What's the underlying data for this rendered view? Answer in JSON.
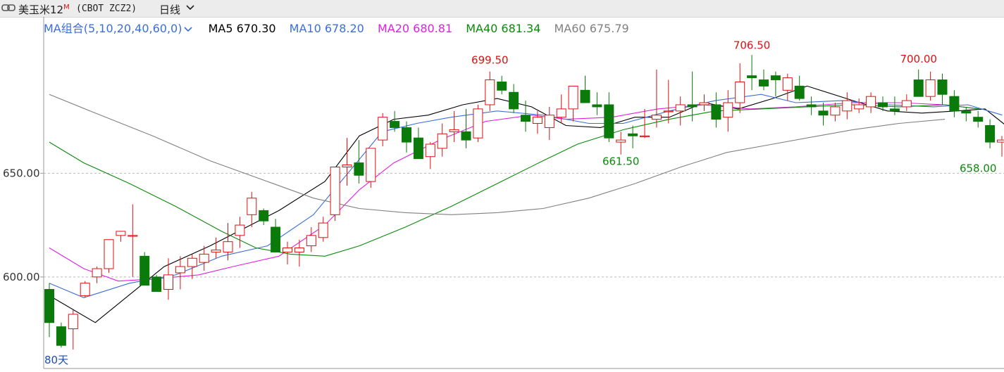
{
  "header": {
    "instrument": "美玉米12",
    "superscript": "M",
    "code": "(CBOT ZCZ2)",
    "period": "日线"
  },
  "ma_legend": [
    {
      "label": "MA组合(5,10,20,40,60,0)",
      "color": "#3b6fd6"
    },
    {
      "label": "MA5 670.30",
      "color": "#000000"
    },
    {
      "label": "MA10 678.20",
      "color": "#3b6fd6"
    },
    {
      "label": "MA20 680.81",
      "color": "#e020e0"
    },
    {
      "label": "MA40 681.34",
      "color": "#0a8a0a"
    },
    {
      "label": "MA60 675.79",
      "color": "#808080"
    }
  ],
  "chart_data": {
    "type": "candlestick",
    "y_ticks": [
      {
        "value": 600,
        "label": "600.00"
      },
      {
        "value": 650,
        "label": "650.00"
      }
    ],
    "ylim": [
      555,
      720
    ],
    "window_label": "80天",
    "annotations": [
      {
        "label": "699.50",
        "index": 37,
        "value": 699.5,
        "position": "above",
        "color": "#e01010"
      },
      {
        "label": "706.50",
        "index": 59,
        "value": 706.5,
        "position": "above",
        "color": "#e01010"
      },
      {
        "label": "661.50",
        "index": 48,
        "value": 661.5,
        "position": "below",
        "color": "#0a8a0a"
      },
      {
        "label": "700.00",
        "index": 73,
        "value": 700.0,
        "position": "above",
        "color": "#e01010"
      },
      {
        "label": "658.00",
        "index": 78,
        "value": 658.0,
        "position": "below",
        "color": "#0a8a0a"
      }
    ],
    "candles": [
      [
        594,
        597,
        571,
        578
      ],
      [
        576,
        578,
        566,
        567
      ],
      [
        575,
        584,
        565,
        582
      ],
      [
        591,
        598,
        590,
        597
      ],
      [
        600,
        605,
        597,
        604
      ],
      [
        604,
        616,
        602,
        618
      ],
      [
        620,
        621,
        617,
        622
      ],
      [
        620,
        635,
        600,
        620
      ],
      [
        610,
        612,
        597,
        596
      ],
      [
        600,
        601,
        593,
        593
      ],
      [
        594,
        609,
        589,
        601
      ],
      [
        602,
        610,
        594,
        605
      ],
      [
        605,
        611,
        599,
        609
      ],
      [
        607,
        615,
        603,
        611
      ],
      [
        612,
        619,
        609,
        613
      ],
      [
        612,
        626,
        608,
        617
      ],
      [
        620,
        629,
        614,
        625
      ],
      [
        630,
        641,
        624,
        638
      ],
      [
        632,
        633,
        625,
        627
      ],
      [
        624,
        628,
        614,
        612
      ],
      [
        612,
        617,
        606,
        614
      ],
      [
        612,
        618,
        605,
        614
      ],
      [
        615,
        624,
        612,
        620
      ],
      [
        619,
        629,
        617,
        626
      ],
      [
        630,
        651,
        627,
        653
      ],
      [
        653,
        667,
        644,
        654
      ],
      [
        655,
        666,
        645,
        649
      ],
      [
        646,
        657,
        643,
        662
      ],
      [
        666,
        679,
        663,
        677
      ],
      [
        675,
        680,
        670,
        672
      ],
      [
        672,
        675,
        660,
        665
      ],
      [
        667,
        672,
        657,
        657
      ],
      [
        658,
        665,
        652,
        664
      ],
      [
        662,
        674,
        658,
        669
      ],
      [
        670,
        680,
        665,
        671
      ],
      [
        670,
        681,
        662,
        666
      ],
      [
        667,
        683,
        665,
        681
      ],
      [
        683,
        699,
        680,
        695
      ],
      [
        694,
        697,
        688,
        690
      ],
      [
        689,
        693,
        679,
        681
      ],
      [
        678,
        685,
        670,
        675
      ],
      [
        674,
        680,
        669,
        677
      ],
      [
        672,
        682,
        666,
        678
      ],
      [
        677,
        688,
        674,
        681
      ],
      [
        681,
        687,
        675,
        692
      ],
      [
        690,
        697,
        685,
        684
      ],
      [
        683,
        689,
        678,
        682
      ],
      [
        683,
        689,
        665,
        667
      ],
      [
        665,
        670,
        659,
        666
      ],
      [
        669,
        673,
        662,
        668
      ],
      [
        668,
        681,
        667,
        668
      ],
      [
        676,
        700,
        672,
        678
      ],
      [
        680,
        695,
        674,
        680
      ],
      [
        680,
        687,
        673,
        683
      ],
      [
        683,
        699,
        675,
        682
      ],
      [
        683,
        688,
        680,
        684
      ],
      [
        683,
        689,
        672,
        676
      ],
      [
        677,
        690,
        670,
        684
      ],
      [
        684,
        703,
        679,
        694
      ],
      [
        697,
        707,
        690,
        696
      ],
      [
        695,
        700,
        690,
        692
      ],
      [
        697,
        699,
        687,
        695
      ],
      [
        690,
        698,
        685,
        696
      ],
      [
        692,
        697,
        685,
        686
      ],
      [
        683,
        687,
        678,
        682
      ],
      [
        680,
        684,
        673,
        678
      ],
      [
        678,
        684,
        675,
        682
      ],
      [
        680,
        689,
        676,
        685
      ],
      [
        681,
        686,
        679,
        683
      ],
      [
        682,
        689,
        679,
        687
      ],
      [
        684,
        687,
        680,
        682
      ],
      [
        681,
        687,
        678,
        680
      ],
      [
        682,
        688,
        680,
        685
      ],
      [
        695,
        700,
        687,
        687
      ],
      [
        687,
        699,
        685,
        695
      ],
      [
        695,
        698,
        683,
        688
      ],
      [
        687,
        690,
        677,
        680
      ],
      [
        680,
        682,
        675,
        679
      ],
      [
        677,
        680,
        672,
        675
      ],
      [
        673,
        676,
        662,
        665
      ],
      [
        665,
        668,
        658,
        666
      ],
      [
        665,
        667,
        662,
        665
      ]
    ],
    "series": [
      {
        "name": "MA5",
        "color": "#000000",
        "values": [
          [
            0,
            591
          ],
          [
            8,
            578
          ],
          [
            20,
            605
          ],
          [
            28,
            615
          ],
          [
            40,
            632
          ],
          [
            48,
            646
          ],
          [
            54,
            668
          ],
          [
            60,
            676
          ],
          [
            66,
            678
          ],
          [
            72,
            683
          ],
          [
            78,
            686
          ],
          [
            84,
            682
          ],
          [
            90,
            673
          ],
          [
            96,
            672
          ],
          [
            102,
            677
          ],
          [
            108,
            677
          ],
          [
            114,
            684
          ],
          [
            120,
            681
          ],
          [
            126,
            686
          ],
          [
            132,
            692
          ],
          [
            140,
            685
          ],
          [
            146,
            680
          ],
          [
            152,
            679
          ],
          [
            158,
            680
          ],
          [
            163,
            681
          ],
          [
            168,
            670
          ]
        ]
      },
      {
        "name": "MA10",
        "color": "#3b6fd6",
        "values": [
          [
            0,
            597
          ],
          [
            6,
            590
          ],
          [
            14,
            597
          ],
          [
            22,
            601
          ],
          [
            30,
            610
          ],
          [
            38,
            615
          ],
          [
            46,
            630
          ],
          [
            52,
            650
          ],
          [
            58,
            670
          ],
          [
            64,
            674
          ],
          [
            70,
            677
          ],
          [
            78,
            680
          ],
          [
            86,
            678
          ],
          [
            94,
            674
          ],
          [
            100,
            674
          ],
          [
            108,
            680
          ],
          [
            116,
            685
          ],
          [
            124,
            688
          ],
          [
            130,
            684
          ],
          [
            138,
            685
          ],
          [
            146,
            683
          ],
          [
            154,
            682
          ],
          [
            160,
            683
          ],
          [
            166,
            678
          ]
        ]
      },
      {
        "name": "MA20",
        "color": "#e020e0",
        "values": [
          [
            0,
            614
          ],
          [
            6,
            604
          ],
          [
            12,
            598
          ],
          [
            18,
            599
          ],
          [
            26,
            601
          ],
          [
            32,
            605
          ],
          [
            40,
            610
          ],
          [
            48,
            625
          ],
          [
            54,
            642
          ],
          [
            60,
            655
          ],
          [
            68,
            666
          ],
          [
            76,
            675
          ],
          [
            84,
            678
          ],
          [
            90,
            676
          ],
          [
            98,
            677
          ],
          [
            106,
            681
          ],
          [
            114,
            683
          ],
          [
            122,
            681
          ],
          [
            130,
            682
          ],
          [
            140,
            684
          ],
          [
            148,
            684
          ],
          [
            156,
            683
          ],
          [
            162,
            681
          ]
        ]
      },
      {
        "name": "MA40",
        "color": "#0a8a0a",
        "values": [
          [
            0,
            665
          ],
          [
            6,
            655
          ],
          [
            14,
            645
          ],
          [
            22,
            634
          ],
          [
            30,
            622
          ],
          [
            36,
            614
          ],
          [
            42,
            611
          ],
          [
            48,
            610
          ],
          [
            54,
            615
          ],
          [
            62,
            624
          ],
          [
            70,
            634
          ],
          [
            78,
            645
          ],
          [
            86,
            656
          ],
          [
            92,
            664
          ],
          [
            100,
            671
          ],
          [
            108,
            676
          ],
          [
            116,
            680
          ],
          [
            124,
            681
          ],
          [
            132,
            682
          ],
          [
            140,
            683
          ],
          [
            148,
            682
          ],
          [
            156,
            683
          ],
          [
            162,
            681
          ]
        ]
      },
      {
        "name": "MA60",
        "color": "#808080",
        "values": [
          [
            0,
            688
          ],
          [
            8,
            679
          ],
          [
            18,
            668
          ],
          [
            28,
            656
          ],
          [
            38,
            646
          ],
          [
            46,
            638
          ],
          [
            54,
            633
          ],
          [
            62,
            631
          ],
          [
            70,
            630
          ],
          [
            78,
            631
          ],
          [
            86,
            633
          ],
          [
            94,
            638
          ],
          [
            102,
            645
          ],
          [
            110,
            653
          ],
          [
            118,
            660
          ],
          [
            126,
            664
          ],
          [
            134,
            668
          ],
          [
            140,
            671
          ],
          [
            148,
            674
          ],
          [
            156,
            676
          ]
        ]
      }
    ]
  }
}
